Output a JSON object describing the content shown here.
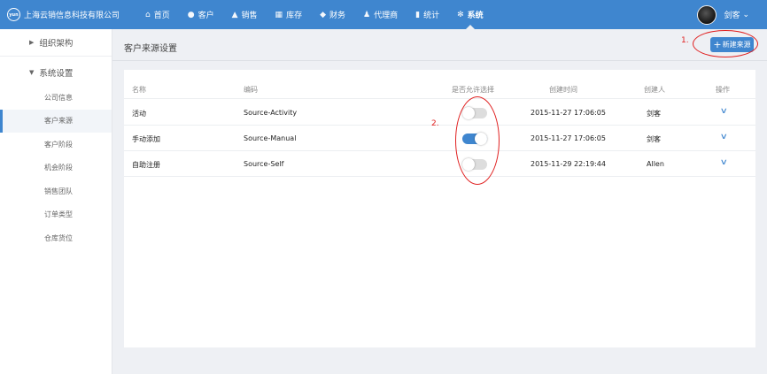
{
  "brand": {
    "logo_text": "yun",
    "name": "上海云销信息科技有限公司"
  },
  "nav": [
    {
      "icon": "home-icon",
      "glyph": "⌂",
      "label": "首页"
    },
    {
      "icon": "user-icon",
      "glyph": "●",
      "label": "客户"
    },
    {
      "icon": "chart-icon",
      "glyph": "▲",
      "label": "销售"
    },
    {
      "icon": "inventory-icon",
      "glyph": "▦",
      "label": "库存"
    },
    {
      "icon": "finance-icon",
      "glyph": "◆",
      "label": "财务"
    },
    {
      "icon": "agents-icon",
      "glyph": "♟",
      "label": "代理商"
    },
    {
      "icon": "stats-icon",
      "glyph": "▮",
      "label": "统计"
    },
    {
      "icon": "gear-icon",
      "glyph": "✻",
      "label": "系统",
      "active": true
    }
  ],
  "user": {
    "name": "剑客",
    "caret": "⌄"
  },
  "sidebar": {
    "org": {
      "arrow": "▶",
      "label": "组织架构"
    },
    "settings": {
      "arrow": "▼",
      "label": "系统设置"
    },
    "items": [
      "公司信息",
      "客户来源",
      "客户阶段",
      "机会阶段",
      "销售团队",
      "订单类型",
      "仓库货位"
    ],
    "active_index": 1
  },
  "page": {
    "title": "客户来源设置",
    "new_button": "新建来源",
    "new_button_glyph": "+"
  },
  "table": {
    "columns": [
      "名称",
      "编码",
      "是否允许选择",
      "创建时间",
      "创建人",
      "操作"
    ],
    "rows": [
      {
        "name": "活动",
        "code": "Source-Activity",
        "allowed": false,
        "created": "2015-11-27 17:06:05",
        "creator": "剑客"
      },
      {
        "name": "手动添加",
        "code": "Source-Manual",
        "allowed": true,
        "created": "2015-11-27 17:06:05",
        "creator": "剑客"
      },
      {
        "name": "自助注册",
        "code": "Source-Self",
        "allowed": false,
        "created": "2015-11-29 22:19:44",
        "creator": "Allen"
      }
    ],
    "action_glyph": "∨"
  },
  "annotations": {
    "label_1": "1.",
    "label_2": "2."
  },
  "colors": {
    "primary": "#3f86cf",
    "annotation": "#e02020"
  }
}
